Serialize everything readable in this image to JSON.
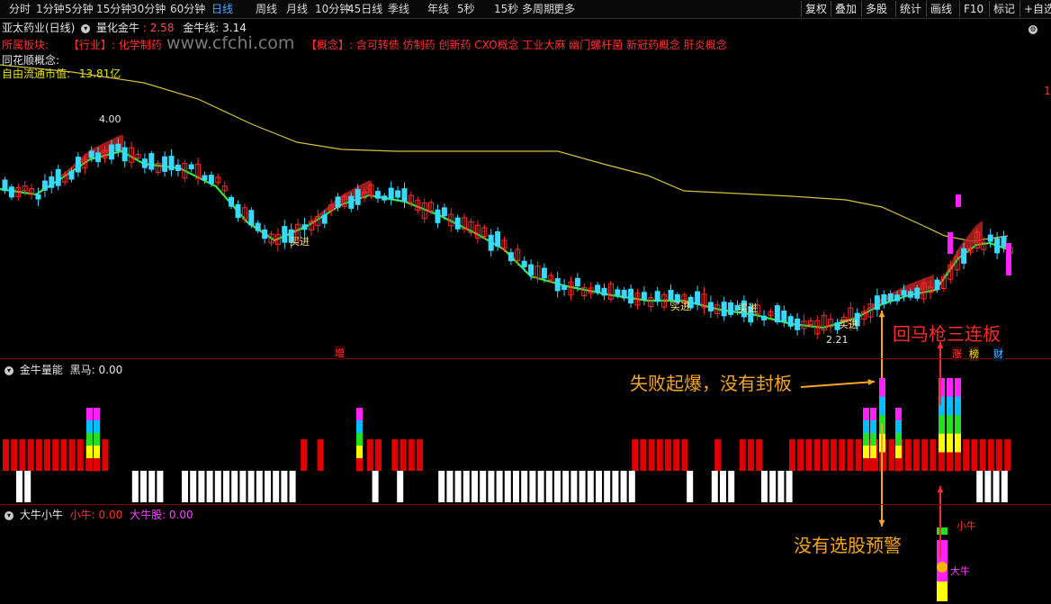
{
  "toolbar": {
    "periods": [
      "分时",
      "1分钟",
      "5分钟",
      "15分钟",
      "30分钟",
      "60分钟",
      "日线",
      "周线",
      "月线",
      "10分钟",
      "45日线",
      "季线",
      "年线",
      "5秒",
      "15秒",
      "多周期",
      "更多"
    ],
    "active_period": "日线",
    "more_label": "更多",
    "right_buttons": [
      "复权",
      "叠加",
      "多股",
      "统计",
      "画线",
      "F10",
      "标记",
      "+自选"
    ]
  },
  "main_panel": {
    "stock_name": "亚太药业(日线)",
    "indicator_name": "量化金牛",
    "value_1": ": 2.58",
    "jinniu_label": "金牛线: 3.14",
    "sector_prefix": "所属板块:",
    "sector_text": "【行业】: 化学制药",
    "concept_text": "【概念】: 含可转债 仿制药 创新药 CXO概念 工业大麻 幽门螺杆菌 新冠药概念 肝炎概念",
    "ths_concept_label": "同花顺概念:",
    "float_cap_label": "自由流通市值:",
    "float_cap_value": "13.81亿",
    "watermark": "www.cfchi.com",
    "right_edge_tag": "1",
    "high_marker": "4.00",
    "low_marker": "2.21",
    "buy_label": "买进",
    "zeng_badge": "增",
    "badges": [
      "涨",
      "榜",
      "财"
    ],
    "colors": {
      "up": "#ff2a2a",
      "down": "#39d9ff",
      "ma_green": "#35e83a",
      "ma_yellow": "#d4c23a",
      "band": "#b82222",
      "magenta": "#ff22ff"
    }
  },
  "vol_panel": {
    "title": "金牛量能",
    "label": "黑马: 0.00"
  },
  "bull_panel": {
    "title": "大牛小牛",
    "small_label": "小牛: 0.00",
    "big_label": "大牛股: 0.00",
    "marker_small": "小牛",
    "marker_big": "大牛"
  },
  "annotations": {
    "huima": "回马枪三连板",
    "failed": "失败起爆，没有封板",
    "no_alert": "没有选股预警"
  },
  "chart_data": {
    "type": "candlestick",
    "title": "亚太药业(日线)",
    "price_high": 4.0,
    "price_low": 2.21,
    "ma_line_label": "金牛线: 3.14",
    "indicator_value": 2.58,
    "annotations": [
      "买进",
      "买进",
      "买进",
      "买进",
      "回马枪三连板"
    ]
  }
}
